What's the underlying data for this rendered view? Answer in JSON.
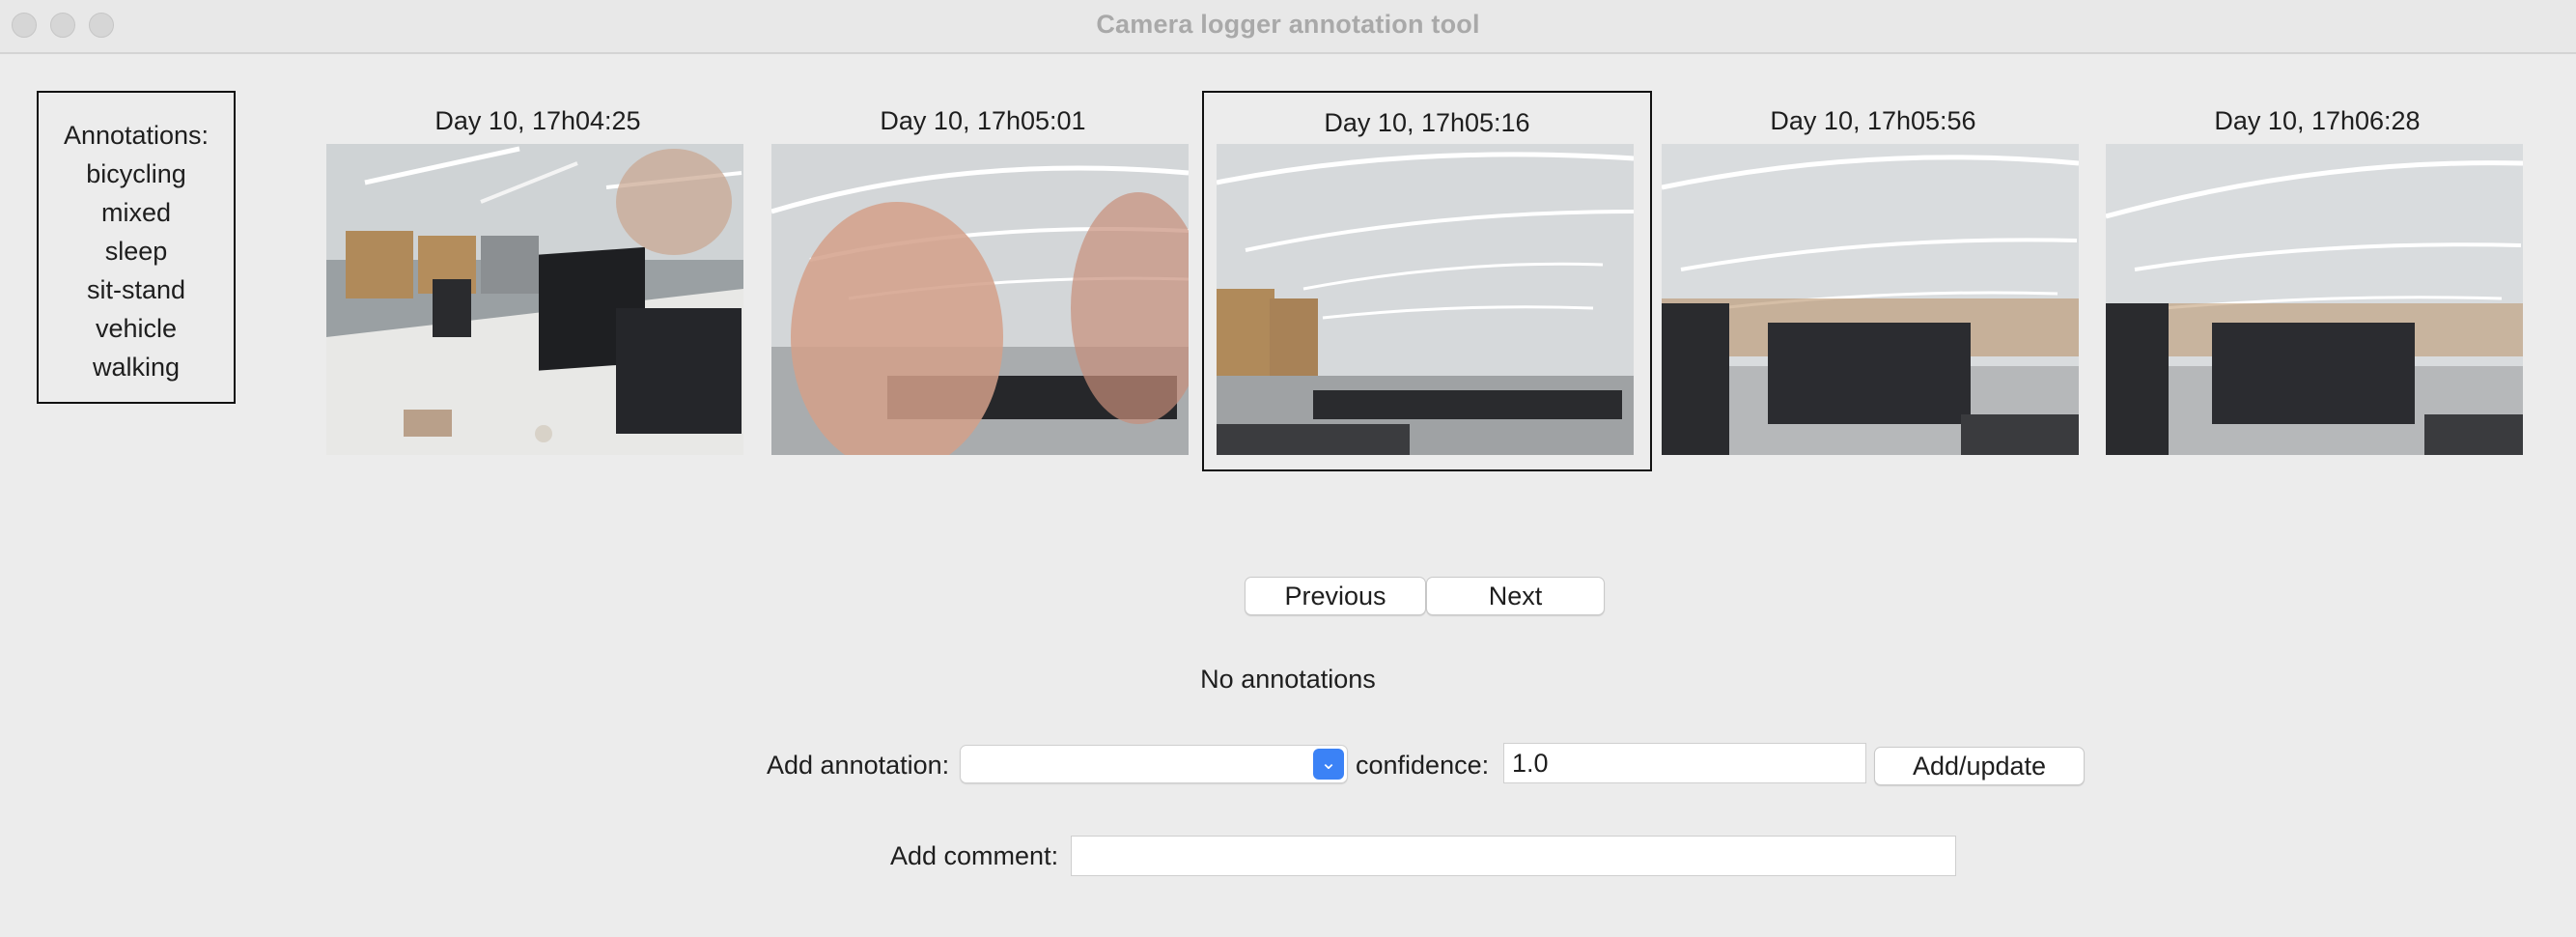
{
  "window": {
    "title": "Camera logger annotation tool"
  },
  "annotations_panel": {
    "header": "Annotations:",
    "items": [
      "bicycling",
      "mixed",
      "sleep",
      "sit-stand",
      "vehicle",
      "walking"
    ]
  },
  "thumbnails": [
    {
      "label": "Day 10, 17h04:25",
      "selected": false
    },
    {
      "label": "Day 10, 17h05:01",
      "selected": false
    },
    {
      "label": "Day 10, 17h05:16",
      "selected": true
    },
    {
      "label": "Day 10, 17h05:56",
      "selected": false
    },
    {
      "label": "Day 10, 17h06:28",
      "selected": false
    }
  ],
  "navigation": {
    "previous_label": "Previous",
    "next_label": "Next"
  },
  "status_text": "No annotations",
  "add_annotation": {
    "label": "Add annotation:",
    "selected_value": "",
    "confidence_label": "confidence:",
    "confidence_value": "1.0",
    "submit_label": "Add/update"
  },
  "add_comment": {
    "label": "Add comment:",
    "value": ""
  },
  "colors": {
    "accent": "#3b82f6",
    "background": "#ececec",
    "title_text": "#a9a9a9"
  }
}
